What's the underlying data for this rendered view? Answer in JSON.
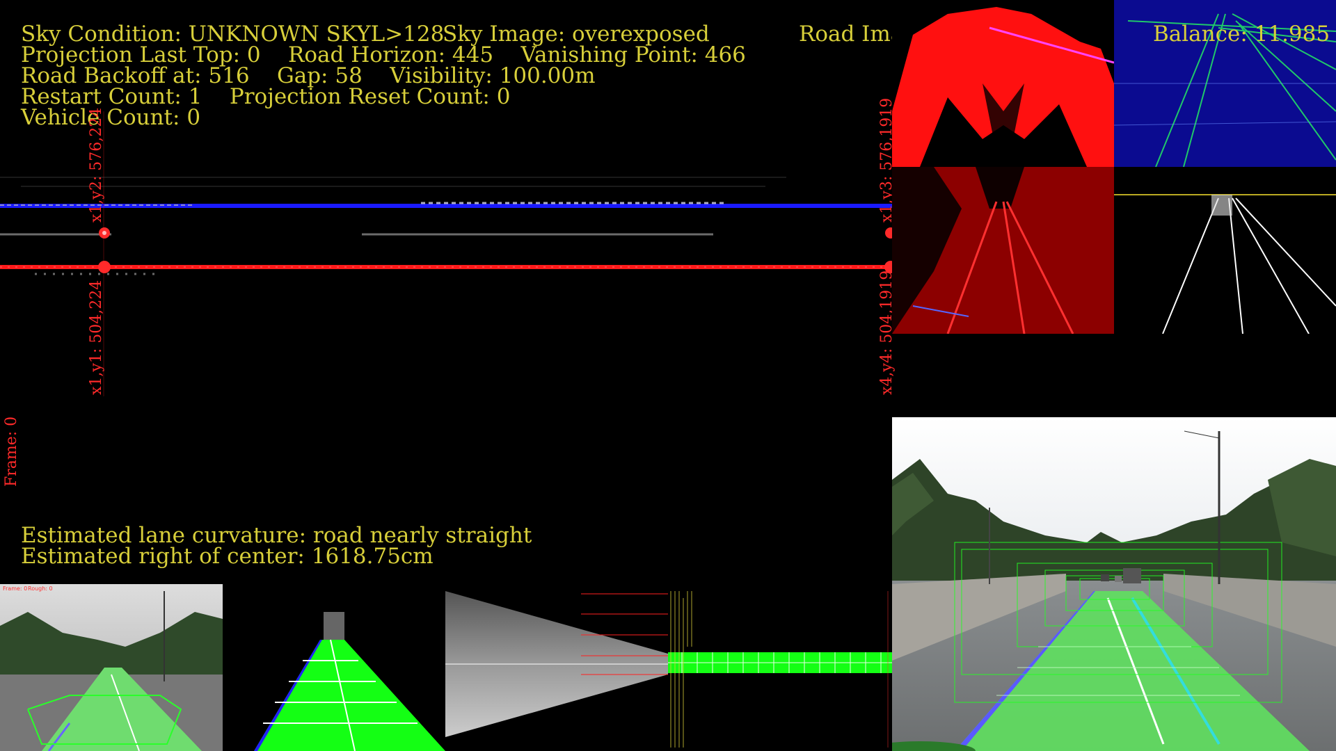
{
  "hud": {
    "line1_a": "Sky Condition: UNKNOWN SKYL>128",
    "line1_b": "Sky Image: overexposed",
    "line1_c": "Road Image: normal",
    "balance": "Balance: 11.985",
    "line2": "Projection Last Top: 0    Road Horizon: 445    Vanishing Point: 466",
    "line3": "Road Backoff at: 516    Gap: 58    Visibility: 100.00m",
    "line4": "Restart Count: 1    Projection Reset Count: 0",
    "line5": "Vehicle Count: 0",
    "curvature": "Estimated lane curvature: road nearly straight",
    "offset": "Estimated right of center: 1618.75cm"
  },
  "markers": {
    "x1y2": "x1,y2: 576,224",
    "x1y1": "x1,y1: 504,224",
    "x1y3": "x1,y3: 576,1919",
    "x4y4": "x4,y4: 504,1919",
    "frame": "Frame: 0"
  },
  "thumb": {
    "frame_text": "Frame: 0",
    "rough_text": "Rough: 0"
  },
  "colors": {
    "hud_text": "#d8cf3a",
    "marker": "#ff2a2a",
    "lane_fill": "#14ff14",
    "horizon_blue": "#1a1aff"
  }
}
